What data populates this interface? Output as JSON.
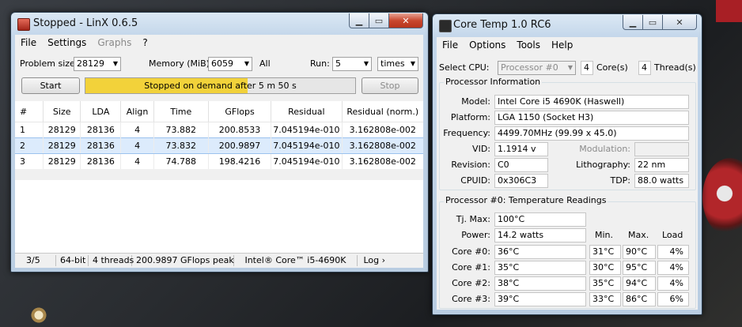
{
  "linx": {
    "title": "Stopped - LinX 0.6.5",
    "menu": [
      {
        "label": "File",
        "disabled": false
      },
      {
        "label": "Settings",
        "disabled": false
      },
      {
        "label": "Graphs",
        "disabled": true
      },
      {
        "label": "?",
        "disabled": false
      }
    ],
    "problem_size_label": "Problem size:",
    "problem_size": "28129",
    "memory_label": "Memory (MiB):",
    "memory": "6059",
    "all_label": "All",
    "run_label": "Run:",
    "run_count": "5",
    "run_unit": "times",
    "start_label": "Start",
    "stop_label": "Stop",
    "progress_text": "Stopped on demand after 5 m 50 s",
    "progress_fraction": 0.6,
    "columns": [
      "#",
      "Size",
      "LDA",
      "Align",
      "Time",
      "GFlops",
      "Residual",
      "Residual (norm.)"
    ],
    "rows": [
      {
        "cells": [
          "1",
          "28129",
          "28136",
          "4",
          "73.882",
          "200.8533",
          "7.045194e-010",
          "3.162808e-002"
        ]
      },
      {
        "cells": [
          "2",
          "28129",
          "28136",
          "4",
          "73.832",
          "200.9897",
          "7.045194e-010",
          "3.162808e-002"
        ]
      },
      {
        "cells": [
          "3",
          "28129",
          "28136",
          "4",
          "74.788",
          "198.4216",
          "7.045194e-010",
          "3.162808e-002"
        ]
      }
    ],
    "selected_row": 1,
    "status": {
      "progress": "3/5",
      "bits": "64-bit",
      "threads": "4 threads",
      "peak": "200.9897 GFlops peak",
      "cpu": "Intel® Core™ i5-4690K",
      "log": "Log ›"
    }
  },
  "coretemp": {
    "title": "Core Temp 1.0 RC6",
    "menu": [
      "File",
      "Options",
      "Tools",
      "Help"
    ],
    "select_cpu_label": "Select CPU:",
    "processor": "Processor #0",
    "cores_count": "4",
    "cores_label": "Core(s)",
    "threads_count": "4",
    "threads_label": "Thread(s)",
    "info_title": "Processor Information",
    "model_label": "Model:",
    "model": "Intel Core i5 4690K (Haswell)",
    "platform_label": "Platform:",
    "platform": "LGA 1150 (Socket H3)",
    "frequency_label": "Frequency:",
    "frequency": "4499.70MHz (99.99 x 45.0)",
    "vid_label": "VID:",
    "vid": "1.1914 v",
    "modulation_label": "Modulation:",
    "modulation": "",
    "revision_label": "Revision:",
    "revision": "C0",
    "lithography_label": "Lithography:",
    "lithography": "22 nm",
    "cpuid_label": "CPUID:",
    "cpuid": "0x306C3",
    "tdp_label": "TDP:",
    "tdp": "88.0 watts",
    "temp_title": "Processor #0: Temperature Readings",
    "tjmax_label": "Tj. Max:",
    "tjmax": "100°C",
    "power_label": "Power:",
    "power": "14.2 watts",
    "col_min": "Min.",
    "col_max": "Max.",
    "col_load": "Load",
    "cores": [
      {
        "label": "Core #0:",
        "temp": "36°C",
        "min": "31°C",
        "max": "90°C",
        "load": "4%"
      },
      {
        "label": "Core #1:",
        "temp": "35°C",
        "min": "30°C",
        "max": "95°C",
        "load": "4%"
      },
      {
        "label": "Core #2:",
        "temp": "38°C",
        "min": "35°C",
        "max": "94°C",
        "load": "4%"
      },
      {
        "label": "Core #3:",
        "temp": "39°C",
        "min": "33°C",
        "max": "86°C",
        "load": "6%"
      }
    ]
  }
}
